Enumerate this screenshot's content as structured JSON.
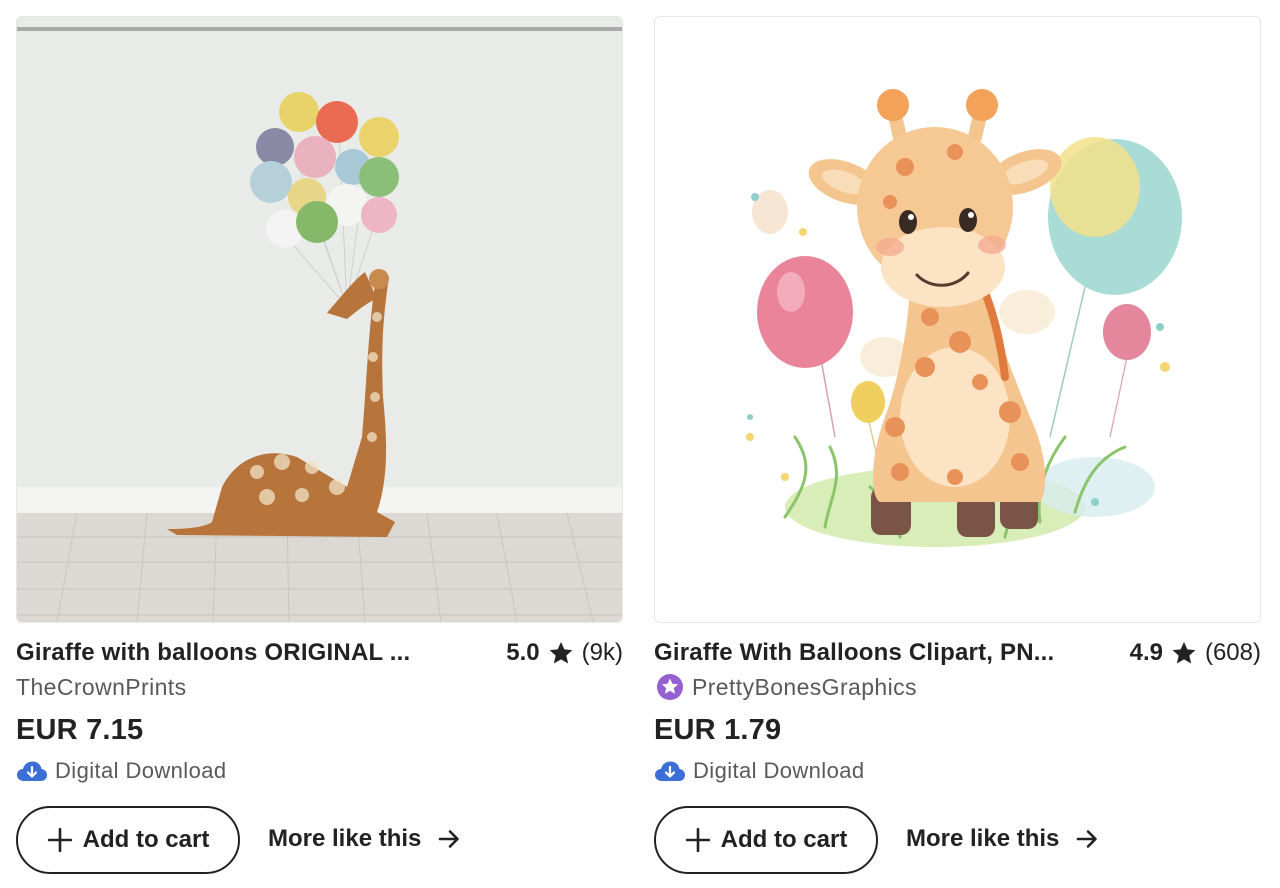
{
  "listings": [
    {
      "title": "Giraffe with balloons ORIGINAL ...",
      "rating": "5.0",
      "review_count": "(9k)",
      "shop": "TheCrownPrints",
      "price": "EUR 7.15",
      "download_label": "Digital Download",
      "add_to_cart_label": "Add to cart",
      "more_like_this_label": "More like this"
    },
    {
      "title": "Giraffe With Balloons Clipart, PN...",
      "rating": "4.9",
      "review_count": "(608)",
      "shop": "PrettyBonesGraphics",
      "shop_badge": "star-seller-icon",
      "price": "EUR 1.79",
      "download_label": "Digital Download",
      "add_to_cart_label": "Add to cart",
      "more_like_this_label": "More like this"
    }
  ],
  "colors": {
    "text": "#222222",
    "muted": "#595959",
    "star_seller": "#9560d1",
    "cloud": "#3b6fd6"
  }
}
